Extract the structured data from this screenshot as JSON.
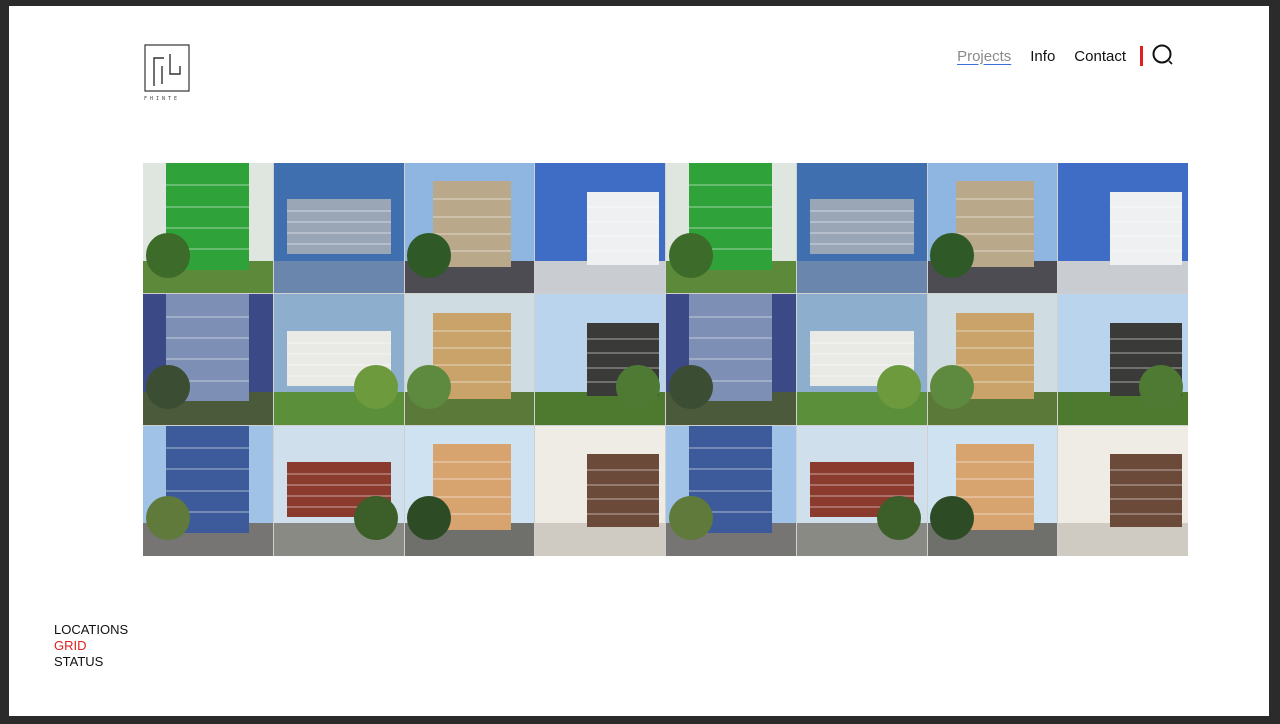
{
  "nav": {
    "items": [
      {
        "label": "Projects",
        "active": true
      },
      {
        "label": "Info",
        "active": false
      },
      {
        "label": "Contact",
        "active": false
      }
    ],
    "search_icon": "search-icon",
    "accent_color": "#e02020",
    "underline_color": "#3a6fd8"
  },
  "logo": {
    "icon": "logo-mark",
    "text": "FHINTE"
  },
  "grid": {
    "columns": 8,
    "rows": 3,
    "tiles": [
      {
        "name": "green-facade",
        "sky": "#dfe6e0",
        "bldg": "#2fa33a",
        "ground": "#5c8a3a",
        "tree": "#3d6b2a"
      },
      {
        "name": "glass-office-reflection",
        "sky": "#3f6fae",
        "bldg": "#9aa6b6",
        "ground": "#6a86ad",
        "tree": null
      },
      {
        "name": "aahhh-oh-tower",
        "sky": "#8eb6e0",
        "bldg": "#b9a88a",
        "ground": "#4c4c52",
        "tree": "#2f5a28"
      },
      {
        "name": "white-houses",
        "sky": "#3f6cc4",
        "bldg": "#eef0f2",
        "ground": "#c9ccd1",
        "tree": null
      },
      {
        "name": "green-facade",
        "sky": "#dfe6e0",
        "bldg": "#2fa33a",
        "ground": "#5c8a3a",
        "tree": "#3d6b2a"
      },
      {
        "name": "glass-office-reflection",
        "sky": "#3f6fae",
        "bldg": "#9aa6b6",
        "ground": "#6a86ad",
        "tree": null
      },
      {
        "name": "aahhh-oh-tower",
        "sky": "#8eb6e0",
        "bldg": "#b9a88a",
        "ground": "#4c4c52",
        "tree": "#2f5a28"
      },
      {
        "name": "white-houses",
        "sky": "#3f6cc4",
        "bldg": "#eef0f2",
        "ground": "#c9ccd1",
        "tree": null
      },
      {
        "name": "glass-dome",
        "sky": "#3b4a86",
        "bldg": "#7d8fb5",
        "ground": "#4a5a3a",
        "tree": "#3b4d33"
      },
      {
        "name": "white-school",
        "sky": "#8eaecd",
        "bldg": "#e9e9e6",
        "ground": "#5c8f3a",
        "tree": "#6c9a3c"
      },
      {
        "name": "stacked-tower",
        "sky": "#cfdde2",
        "bldg": "#c9a36a",
        "ground": "#5b7a3a",
        "tree": "#5e8a3f"
      },
      {
        "name": "spiral-stair-block",
        "sky": "#b9d4ec",
        "bldg": "#3a3a38",
        "ground": "#4d7a2f",
        "tree": "#4f7a34"
      },
      {
        "name": "glass-dome",
        "sky": "#3b4a86",
        "bldg": "#7d8fb5",
        "ground": "#4a5a3a",
        "tree": "#3b4d33"
      },
      {
        "name": "white-school",
        "sky": "#8eaecd",
        "bldg": "#e9e9e6",
        "ground": "#5c8f3a",
        "tree": "#6c9a3c"
      },
      {
        "name": "stacked-tower",
        "sky": "#cfdde2",
        "bldg": "#c9a36a",
        "ground": "#5b7a3a",
        "tree": "#5e8a3f"
      },
      {
        "name": "spiral-stair-block",
        "sky": "#b9d4ec",
        "bldg": "#3a3a38",
        "ground": "#4d7a2f",
        "tree": "#4f7a34"
      },
      {
        "name": "curved-glass-tower",
        "sky": "#9fc2e6",
        "bldg": "#3d5b9a",
        "ground": "#767574",
        "tree": "#5f7a3a"
      },
      {
        "name": "red-stair-building",
        "sky": "#cfe0ec",
        "bldg": "#8b3a2e",
        "ground": "#8a8a84",
        "tree": "#3c5e29"
      },
      {
        "name": "timber-apartments",
        "sky": "#cfe2f1",
        "bldg": "#d7a36f",
        "ground": "#6f6f6c",
        "tree": "#2d4b24"
      },
      {
        "name": "interior-lobby",
        "sky": "#efece6",
        "bldg": "#6b4a3a",
        "ground": "#cfcac2",
        "tree": null
      },
      {
        "name": "curved-glass-tower",
        "sky": "#9fc2e6",
        "bldg": "#3d5b9a",
        "ground": "#767574",
        "tree": "#5f7a3a"
      },
      {
        "name": "red-stair-building",
        "sky": "#cfe0ec",
        "bldg": "#8b3a2e",
        "ground": "#8a8a84",
        "tree": "#3c5e29"
      },
      {
        "name": "timber-apartments",
        "sky": "#cfe2f1",
        "bldg": "#d7a36f",
        "ground": "#6f6f6c",
        "tree": "#2d4b24"
      },
      {
        "name": "interior-lobby",
        "sky": "#efece6",
        "bldg": "#6b4a3a",
        "ground": "#cfcac2",
        "tree": null
      }
    ]
  },
  "filters": {
    "items": [
      {
        "label": "LOCATIONS",
        "active": false
      },
      {
        "label": "GRID",
        "active": true
      },
      {
        "label": "STATUS",
        "active": false
      }
    ]
  }
}
